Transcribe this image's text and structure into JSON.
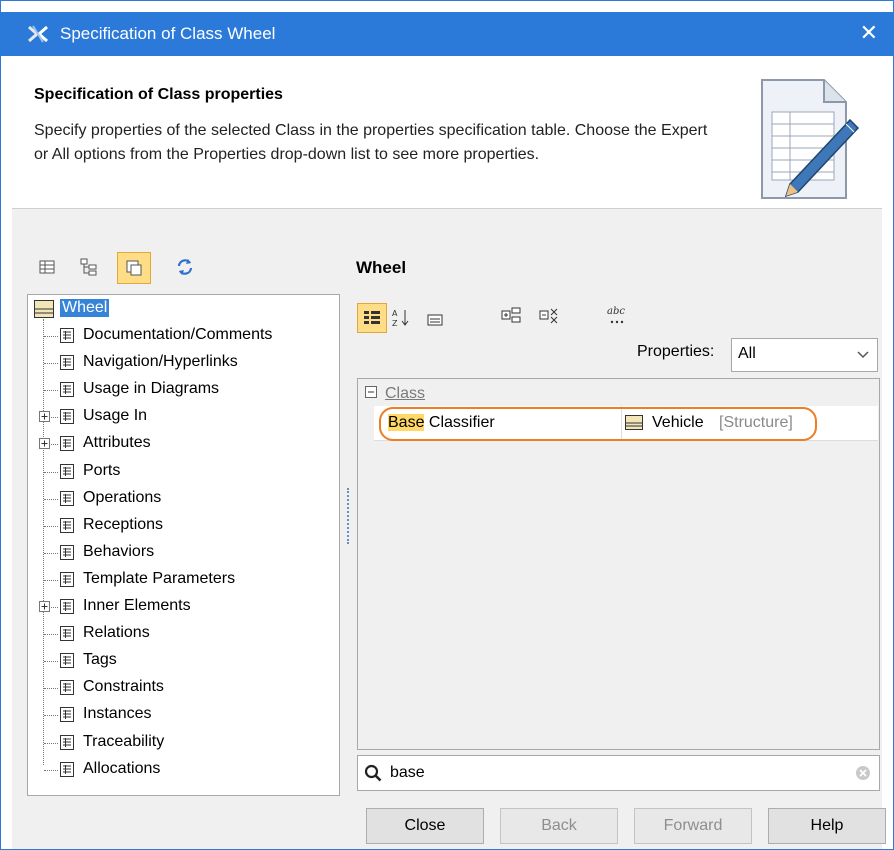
{
  "window": {
    "title": "Specification of Class Wheel",
    "close_glyph": "✕"
  },
  "header": {
    "title": "Specification of Class properties",
    "description": "Specify properties of the selected Class in the properties specification table. Choose the Expert or All options from the Properties drop-down list to see more properties."
  },
  "left_toolbar": {
    "icons": [
      "table-view-icon",
      "tree-view-icon",
      "toggle-view-icon",
      "refresh-icon"
    ]
  },
  "tree": {
    "root": "Wheel",
    "items": [
      {
        "label": "Documentation/Comments",
        "expandable": false
      },
      {
        "label": "Navigation/Hyperlinks",
        "expandable": false
      },
      {
        "label": "Usage in Diagrams",
        "expandable": false
      },
      {
        "label": "Usage In",
        "expandable": true
      },
      {
        "label": "Attributes",
        "expandable": true
      },
      {
        "label": "Ports",
        "expandable": false
      },
      {
        "label": "Operations",
        "expandable": false
      },
      {
        "label": "Receptions",
        "expandable": false
      },
      {
        "label": "Behaviors",
        "expandable": false
      },
      {
        "label": "Template Parameters",
        "expandable": false
      },
      {
        "label": "Inner Elements",
        "expandable": true
      },
      {
        "label": "Relations",
        "expandable": false
      },
      {
        "label": "Tags",
        "expandable": false
      },
      {
        "label": "Constraints",
        "expandable": false
      },
      {
        "label": "Instances",
        "expandable": false
      },
      {
        "label": "Traceability",
        "expandable": false
      },
      {
        "label": "Allocations",
        "expandable": false
      }
    ]
  },
  "right_panel": {
    "title": "Wheel",
    "toolbar_icons": [
      "categorized-icon",
      "sort-alpha-icon",
      "single-column-icon",
      "expand-all-icon",
      "collapse-all-icon",
      "abc-display-icon"
    ],
    "properties_label": "Properties:",
    "properties_value": "All",
    "group": "Class",
    "row": {
      "name_highlight": "Base",
      "name_rest": " Classifier",
      "value": "Vehicle",
      "value_type": "[Structure]"
    },
    "search_value": "base"
  },
  "buttons": {
    "close": "Close",
    "back": "Back",
    "forward": "Forward",
    "help": "Help"
  },
  "colors": {
    "title_bar": "#2b79d8",
    "selection": "#3584d8",
    "highlight": "#ffd866",
    "callout": "#ee7d23"
  }
}
